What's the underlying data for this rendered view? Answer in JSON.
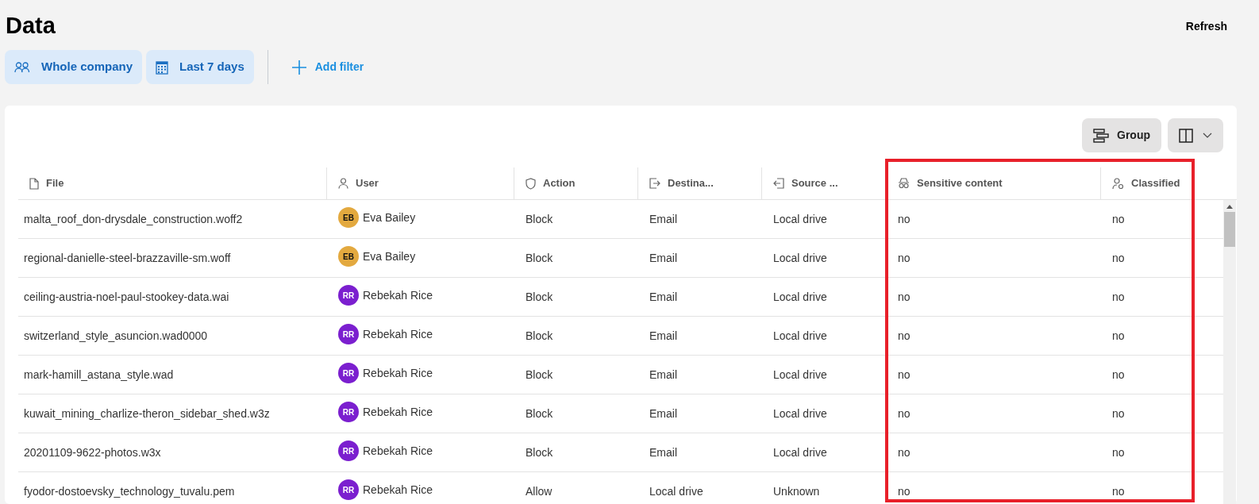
{
  "page": {
    "title": "Data",
    "refresh": "Refresh"
  },
  "filters": [
    {
      "kind": "people",
      "label": "Whole company"
    },
    {
      "kind": "calendar",
      "label": "Last 7 days"
    }
  ],
  "add_filter": "Add filter",
  "toolbar": {
    "group": "Group"
  },
  "table": {
    "columns": [
      {
        "kind": "file",
        "label": "File"
      },
      {
        "kind": "user",
        "label": "User"
      },
      {
        "kind": "shield",
        "label": "Action"
      },
      {
        "kind": "export",
        "label": "Destina..."
      },
      {
        "kind": "import",
        "label": "Source ..."
      },
      {
        "kind": "spy",
        "label": "Sensitive content"
      },
      {
        "kind": "classified",
        "label": "Classified"
      }
    ],
    "rows": [
      {
        "file": "malta_roof_don-drysdale_construction.woff2",
        "initials": "EB",
        "color": "#e3a93f",
        "user": "Eva Bailey",
        "action": "Block",
        "destination": "Email",
        "source": "Local drive",
        "sensitive": "no",
        "classified": "no"
      },
      {
        "file": "regional-danielle-steel-brazzaville-sm.woff",
        "initials": "EB",
        "color": "#e3a93f",
        "user": "Eva Bailey",
        "action": "Block",
        "destination": "Email",
        "source": "Local drive",
        "sensitive": "no",
        "classified": "no"
      },
      {
        "file": "ceiling-austria-noel-paul-stookey-data.wai",
        "initials": "RR",
        "color": "#7b1fcf",
        "user": "Rebekah Rice",
        "action": "Block",
        "destination": "Email",
        "source": "Local drive",
        "sensitive": "no",
        "classified": "no"
      },
      {
        "file": "switzerland_style_asuncion.wad0000",
        "initials": "RR",
        "color": "#7b1fcf",
        "user": "Rebekah Rice",
        "action": "Block",
        "destination": "Email",
        "source": "Local drive",
        "sensitive": "no",
        "classified": "no"
      },
      {
        "file": "mark-hamill_astana_style.wad",
        "initials": "RR",
        "color": "#7b1fcf",
        "user": "Rebekah Rice",
        "action": "Block",
        "destination": "Email",
        "source": "Local drive",
        "sensitive": "no",
        "classified": "no"
      },
      {
        "file": "kuwait_mining_charlize-theron_sidebar_shed.w3z",
        "initials": "RR",
        "color": "#7b1fcf",
        "user": "Rebekah Rice",
        "action": "Block",
        "destination": "Email",
        "source": "Local drive",
        "sensitive": "no",
        "classified": "no"
      },
      {
        "file": "20201109-9622-photos.w3x",
        "initials": "RR",
        "color": "#7b1fcf",
        "user": "Rebekah Rice",
        "action": "Block",
        "destination": "Email",
        "source": "Local drive",
        "sensitive": "no",
        "classified": "no"
      },
      {
        "file": "fyodor-dostoevsky_technology_tuvalu.pem",
        "initials": "RR",
        "color": "#7b1fcf",
        "user": "Rebekah Rice",
        "action": "Allow",
        "destination": "Local drive",
        "source": "Unknown",
        "sensitive": "no",
        "classified": "no"
      }
    ]
  }
}
